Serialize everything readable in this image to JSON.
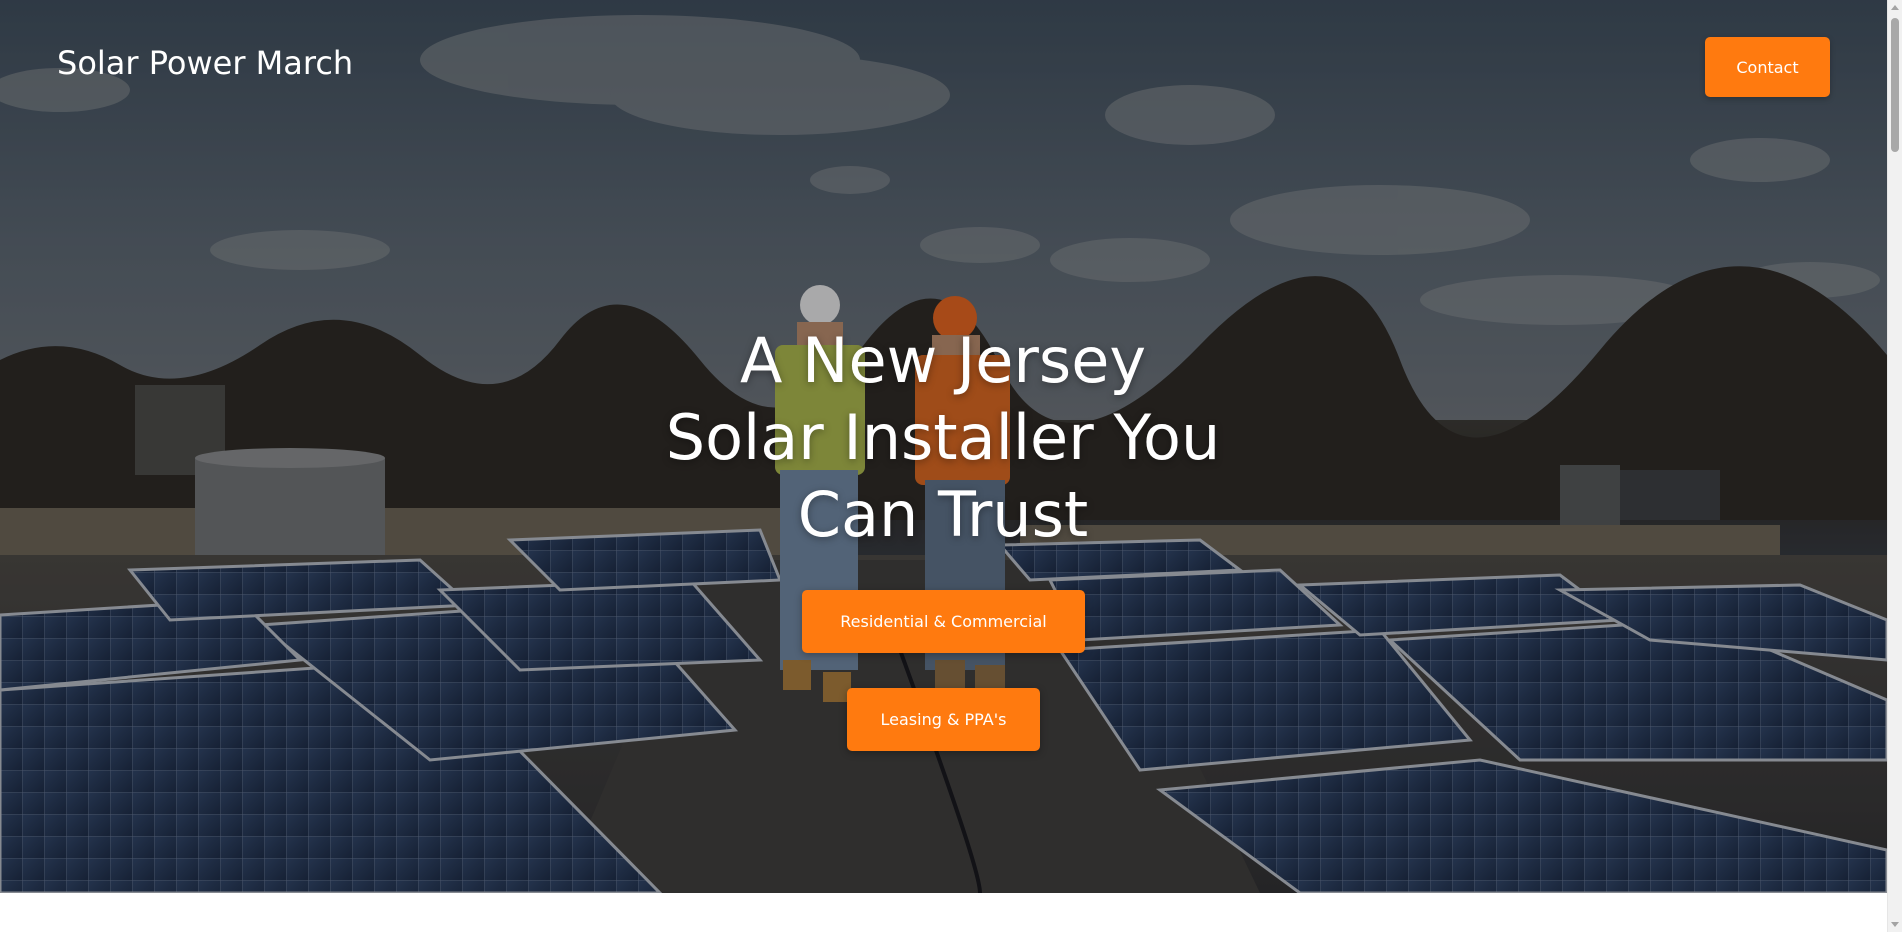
{
  "header": {
    "site_title": "Solar Power March",
    "contact_label": "Contact"
  },
  "hero": {
    "heading_line1": "A New Jersey",
    "heading_line2": "Solar Installer You",
    "heading_line3": "Can Trust",
    "cta_residential_label": "Residential & Commercial",
    "cta_leasing_label": "Leasing & PPA's",
    "background_image": "solar-panels-rooftop-workers-photo"
  },
  "colors": {
    "accent": "#ff7a0f",
    "text_light": "#ffffff"
  },
  "icons": {
    "scroll_up": "triangle-up",
    "scroll_down": "triangle-down"
  }
}
